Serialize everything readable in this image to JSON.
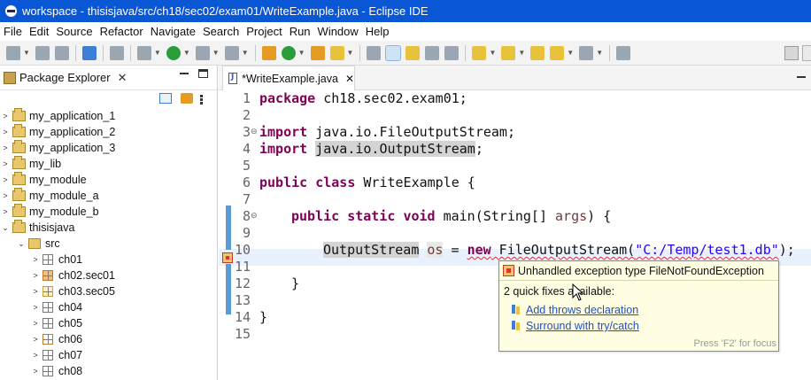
{
  "window": {
    "title": "workspace - thisisjava/src/ch18/sec02/exam01/WriteExample.java - Eclipse IDE"
  },
  "menu": [
    "File",
    "Edit",
    "Source",
    "Refactor",
    "Navigate",
    "Search",
    "Project",
    "Run",
    "Window",
    "Help"
  ],
  "package_explorer": {
    "title": "Package Explorer",
    "projects": [
      "my_application_1",
      "my_application_2",
      "my_application_3",
      "my_lib",
      "my_module",
      "my_module_a",
      "my_module_b",
      "thisisjava"
    ],
    "src_label": "src",
    "packages": [
      "ch01",
      "ch02.sec01",
      "ch03.sec05",
      "ch04",
      "ch05",
      "ch06",
      "ch07",
      "ch08"
    ]
  },
  "editor": {
    "tab_label": "*WriteExample.java",
    "line_numbers": [
      "1",
      "2",
      "3",
      "4",
      "5",
      "6",
      "7",
      "8",
      "9",
      "10",
      "11",
      "12",
      "13",
      "14",
      "15"
    ],
    "code": {
      "l1_kw": "package",
      "l1_rest": " ch18.sec02.exam01;",
      "l3_kw": "import",
      "l3_rest": " java.io.FileOutputStream;",
      "l4_kw": "import",
      "l4_sp": " ",
      "l4_hl": "java.io.OutputStream",
      "l4_end": ";",
      "l6_kw1": "public",
      "l6_kw2": "class",
      "l6_rest": " WriteExample {",
      "l8_kw1": "public",
      "l8_kw2": "static",
      "l8_kw3": "void",
      "l8_rest1": " main(String[] ",
      "l8_var": "args",
      "l8_rest2": ") {",
      "l10_type": "OutputStream",
      "l10_var": "os",
      "l10_eq": " = ",
      "l10_new": "new",
      "l10_ctor": " FileOutputStream(",
      "l10_str": "\"C:/Temp/test1.db\"",
      "l10_end": ");",
      "l12_brace": "}",
      "l14_brace": "}"
    }
  },
  "quickfix": {
    "title": "Unhandled exception type FileNotFoundException",
    "count_text": "2 quick fixes available:",
    "fixes": [
      "Add throws declaration",
      "Surround with try/catch"
    ],
    "footer": "Press 'F2' for focus"
  }
}
